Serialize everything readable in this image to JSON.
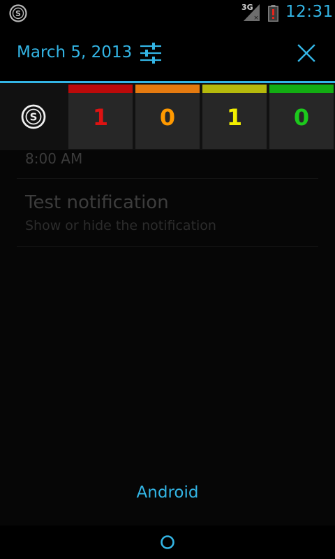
{
  "status_bar": {
    "network_type": "3G",
    "time": "12:31",
    "app_icon": "stepcounter-s-icon",
    "signal_icon": "signal-no-data-icon",
    "battery_icon": "battery-alert-icon"
  },
  "header": {
    "date": "March 5, 2013",
    "settings_icon": "sliders-settings-icon",
    "clear_icon": "close-icon"
  },
  "counter_notification": {
    "app_icon": "stepcounter-s-icon",
    "tiles": [
      {
        "value": "1",
        "color": "#dd1212",
        "band_color": "#bb0a0a"
      },
      {
        "value": "0",
        "color": "#ff9900",
        "band_color": "#e47a10"
      },
      {
        "value": "1",
        "color": "#f2ef00",
        "band_color": "#b5b90c"
      },
      {
        "value": "0",
        "color": "#1cc91c",
        "band_color": "#12ad12"
      }
    ]
  },
  "background_list": {
    "time_value": "8:00 AM",
    "item_title": "Test notification",
    "item_summary": "Show or hide the notification"
  },
  "footer": {
    "carrier": "Android",
    "home_icon": "home-circle-icon"
  },
  "colors": {
    "accent": "#33b5e5"
  }
}
